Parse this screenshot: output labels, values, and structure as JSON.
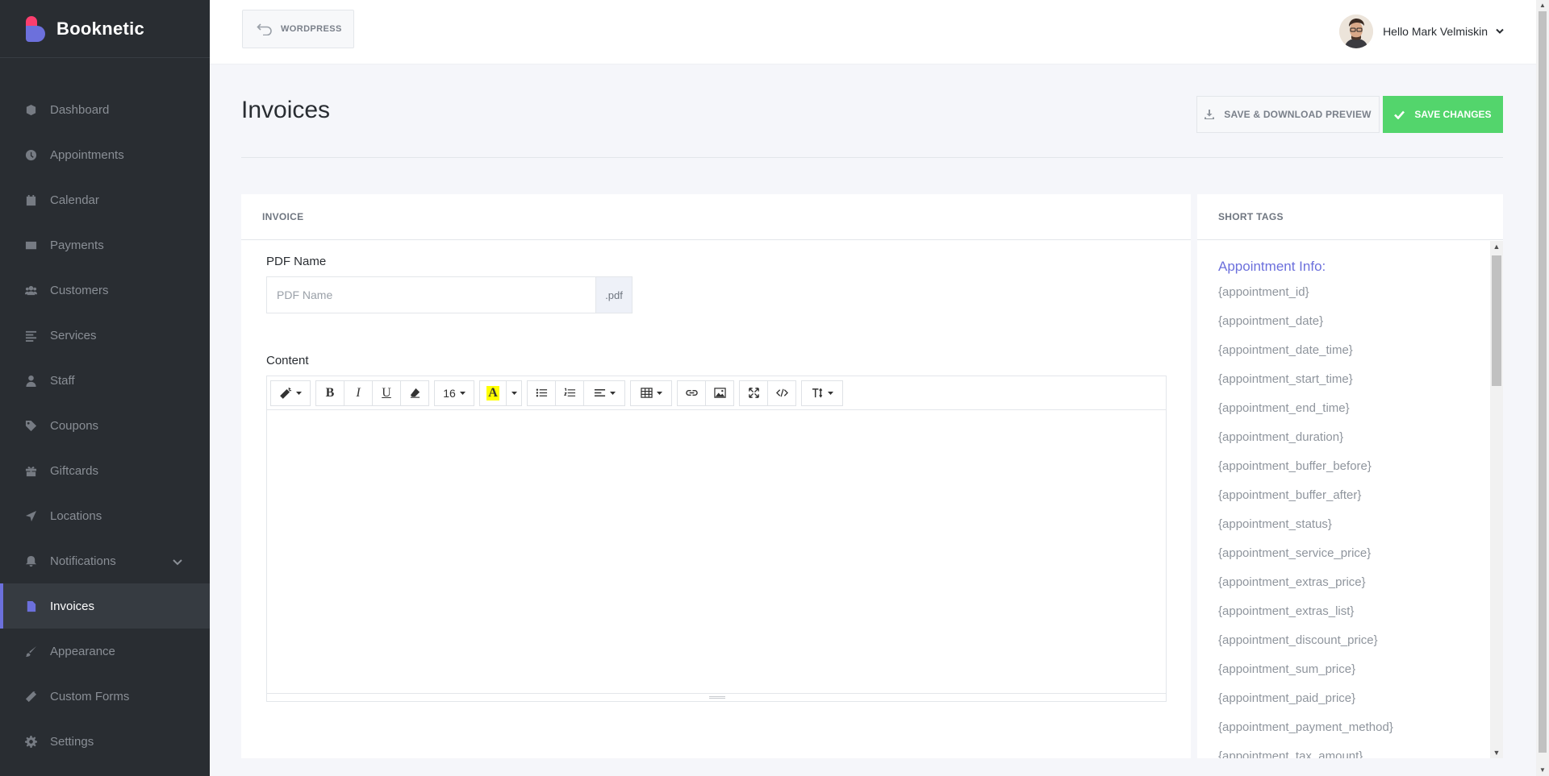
{
  "brand": {
    "name": "Booknetic"
  },
  "sidebar": {
    "items": [
      {
        "label": "Dashboard",
        "icon": "cube-icon"
      },
      {
        "label": "Appointments",
        "icon": "clock-icon"
      },
      {
        "label": "Calendar",
        "icon": "calendar-icon"
      },
      {
        "label": "Payments",
        "icon": "credit-card-icon"
      },
      {
        "label": "Customers",
        "icon": "users-icon"
      },
      {
        "label": "Services",
        "icon": "list-icon"
      },
      {
        "label": "Staff",
        "icon": "user-icon"
      },
      {
        "label": "Coupons",
        "icon": "tag-icon"
      },
      {
        "label": "Giftcards",
        "icon": "gift-icon"
      },
      {
        "label": "Locations",
        "icon": "location-arrow-icon"
      },
      {
        "label": "Notifications",
        "icon": "bell-icon"
      },
      {
        "label": "Invoices",
        "icon": "file-icon"
      },
      {
        "label": "Appearance",
        "icon": "brush-icon"
      },
      {
        "label": "Custom Forms",
        "icon": "magic-wand-icon"
      },
      {
        "label": "Settings",
        "icon": "gear-icon"
      }
    ],
    "active": "Invoices"
  },
  "topbar": {
    "wordpress_label": "WORDPRESS",
    "greeting": "Hello Mark Velmiskin"
  },
  "page": {
    "title": "Invoices",
    "preview_button": "SAVE & DOWNLOAD PREVIEW",
    "save_button": "SAVE CHANGES"
  },
  "invoice": {
    "heading": "INVOICE",
    "pdf_name_label": "PDF Name",
    "pdf_name_placeholder": "PDF Name",
    "pdf_name_value": "",
    "pdf_suffix": ".pdf",
    "content_label": "Content",
    "font_size": "16"
  },
  "short_tags": {
    "heading": "SHORT TAGS",
    "group_title": "Appointment Info:",
    "tags": [
      "{appointment_id}",
      "{appointment_date}",
      "{appointment_date_time}",
      "{appointment_start_time}",
      "{appointment_end_time}",
      "{appointment_duration}",
      "{appointment_buffer_before}",
      "{appointment_buffer_after}",
      "{appointment_status}",
      "{appointment_service_price}",
      "{appointment_extras_price}",
      "{appointment_extras_list}",
      "{appointment_discount_price}",
      "{appointment_sum_price}",
      "{appointment_paid_price}",
      "{appointment_payment_method}",
      "{appointment_tax_amount}"
    ]
  },
  "colors": {
    "sidebar_bg": "#292d32",
    "accent": "#6c70dc",
    "save_green": "#53d56c",
    "brand_pink": "#fb3e6e"
  }
}
